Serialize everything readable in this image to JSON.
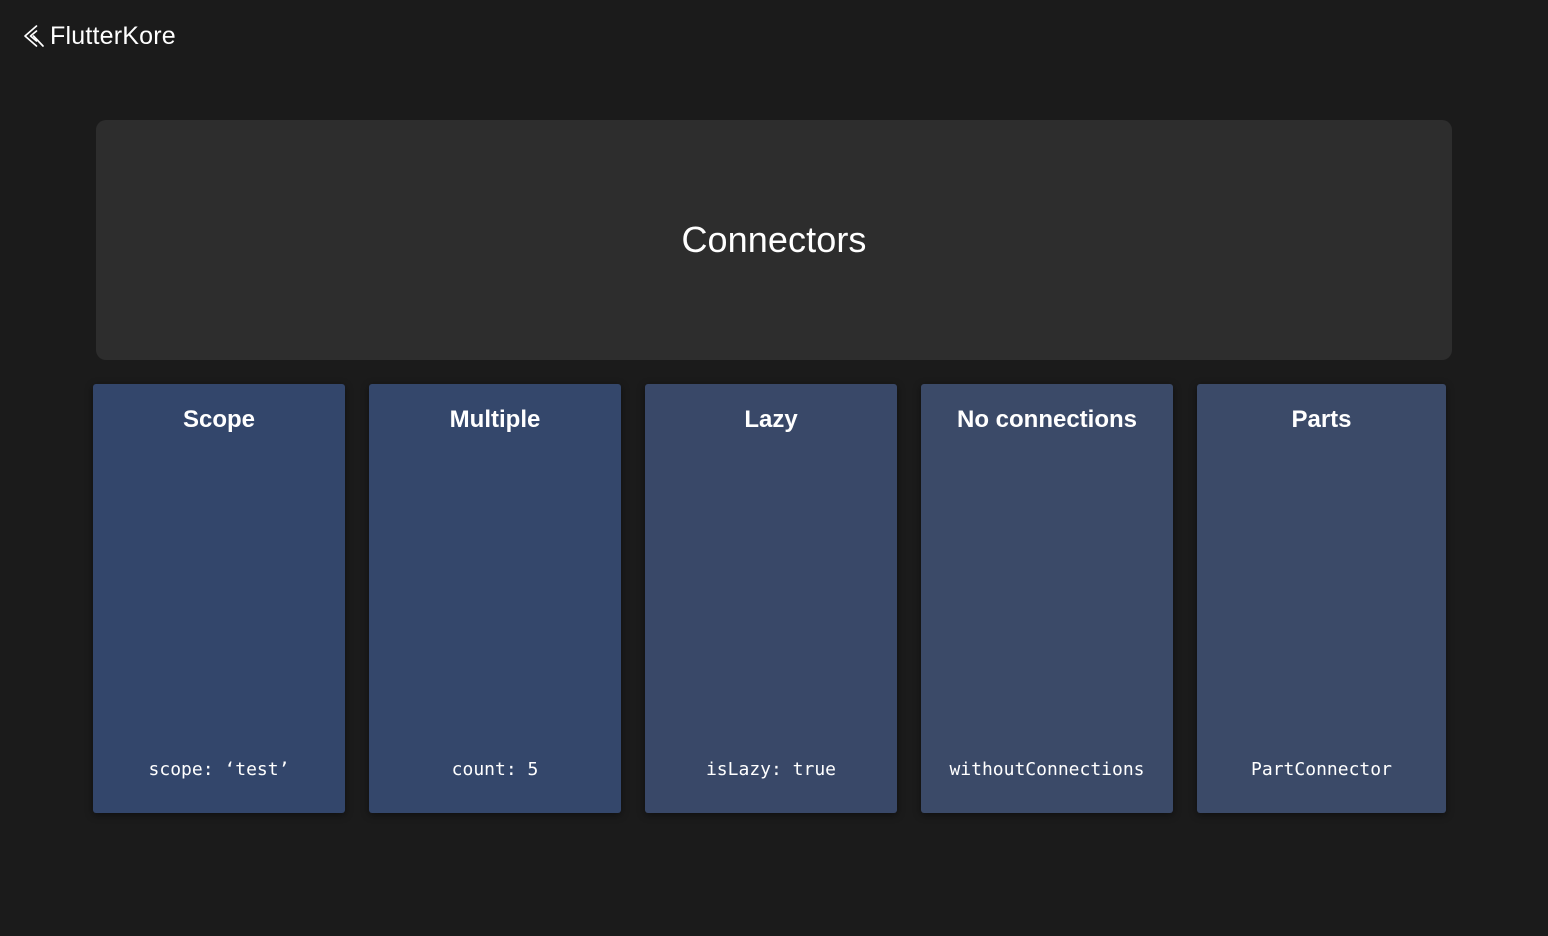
{
  "header": {
    "brand": "FlutterKore",
    "logo_icon": "flutter-logo-icon"
  },
  "hero": {
    "title": "Connectors",
    "background": "#2d2d2d"
  },
  "cards": [
    {
      "title": "Scope",
      "code": "scope: ‘test’",
      "color": "#33466b"
    },
    {
      "title": "Multiple",
      "code": "count: 5",
      "color": "#34476b"
    },
    {
      "title": "Lazy",
      "code": "isLazy: true",
      "color": "#394868"
    },
    {
      "title": "No connections",
      "code": "withoutConnections",
      "color": "#3b4a68"
    },
    {
      "title": "Parts",
      "code": "PartConnector",
      "color": "#3b4a68"
    }
  ],
  "theme": {
    "page_background": "#1b1b1b",
    "text": "#ffffff"
  }
}
